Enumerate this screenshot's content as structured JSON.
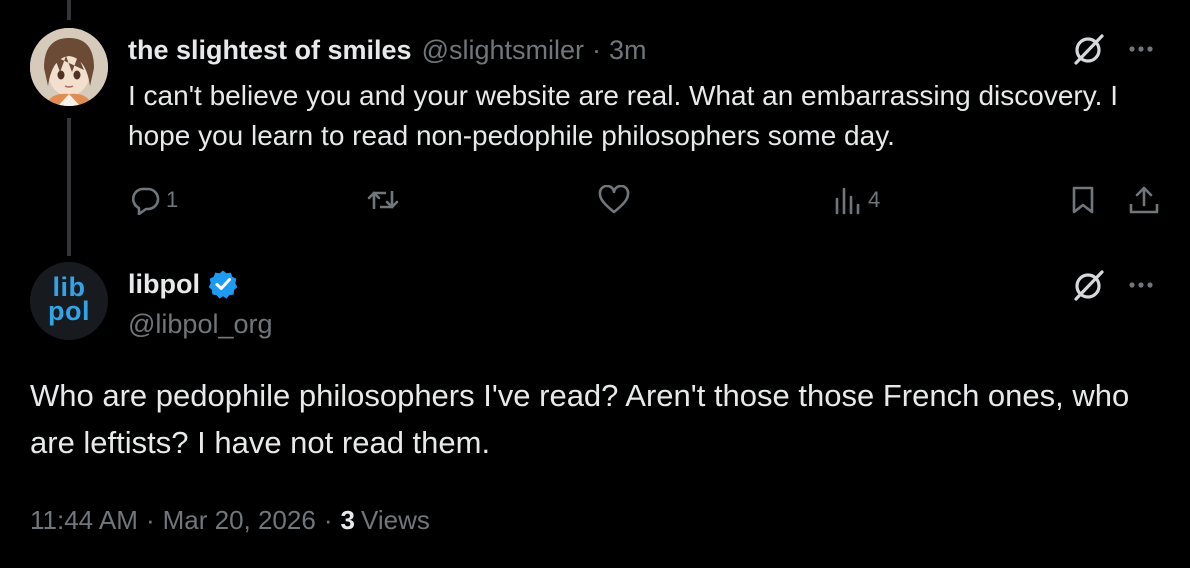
{
  "reply": {
    "display_name": "the slightest of smiles",
    "handle": "@slightsmiler",
    "separator": "·",
    "time": "3m",
    "text": "I can't believe you and your website are real. What an embarrassing discovery. I hope you learn to read non-pedophile philosophers some day.",
    "actions": {
      "reply_count": "1",
      "repost_count": "",
      "like_count": "",
      "views_count": "4"
    }
  },
  "main": {
    "avatar_logo_line1": "lib",
    "avatar_logo_line2": "pol",
    "display_name": "libpol",
    "handle": "@libpol_org",
    "text": "Who are pedophile philosophers I've read? Aren't those those French ones, who are leftists? I have not read them.",
    "meta": {
      "time": "11:44 AM",
      "sep1": "·",
      "date": "Mar 20, 2026",
      "sep2": "·",
      "views_count": "3",
      "views_label": "Views"
    }
  },
  "colors": {
    "background": "#000000",
    "text_primary": "#e7e9ea",
    "text_secondary": "#71767b",
    "verified_blue": "#1d9bf0",
    "logo_blue": "#34a3e6"
  },
  "icons": [
    "grok-icon",
    "more-icon",
    "reply-icon",
    "repost-icon",
    "like-icon",
    "views-icon",
    "bookmark-icon",
    "share-icon",
    "verified-badge-icon"
  ]
}
